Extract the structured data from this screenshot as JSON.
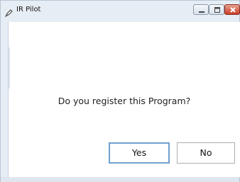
{
  "window": {
    "title": "IR Pilot",
    "controls": {
      "minimize_icon": "minimize-icon",
      "maximize_icon": "maximize-icon",
      "close_icon": "close-icon"
    }
  },
  "dialog": {
    "message": "Do you register this Program?",
    "buttons": {
      "yes_label": "Yes",
      "no_label": "No"
    }
  },
  "colors": {
    "frame": "#e7edf4",
    "client": "#ffffff",
    "focus_border": "#6fa0d0",
    "close_button": "#c83c28"
  }
}
